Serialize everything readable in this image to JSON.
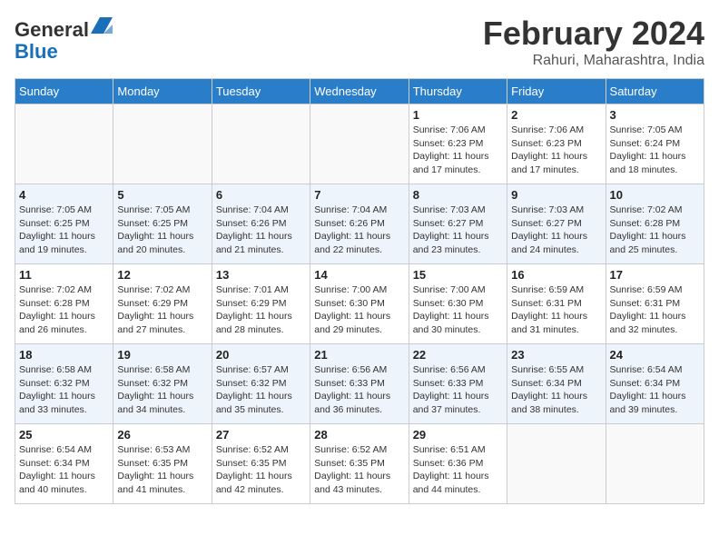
{
  "header": {
    "logo_general": "General",
    "logo_blue": "Blue",
    "month_year": "February 2024",
    "location": "Rahuri, Maharashtra, India"
  },
  "days_of_week": [
    "Sunday",
    "Monday",
    "Tuesday",
    "Wednesday",
    "Thursday",
    "Friday",
    "Saturday"
  ],
  "weeks": [
    [
      {
        "day": "",
        "info": ""
      },
      {
        "day": "",
        "info": ""
      },
      {
        "day": "",
        "info": ""
      },
      {
        "day": "",
        "info": ""
      },
      {
        "day": "1",
        "info": "Sunrise: 7:06 AM\nSunset: 6:23 PM\nDaylight: 11 hours and 17 minutes."
      },
      {
        "day": "2",
        "info": "Sunrise: 7:06 AM\nSunset: 6:23 PM\nDaylight: 11 hours and 17 minutes."
      },
      {
        "day": "3",
        "info": "Sunrise: 7:05 AM\nSunset: 6:24 PM\nDaylight: 11 hours and 18 minutes."
      }
    ],
    [
      {
        "day": "4",
        "info": "Sunrise: 7:05 AM\nSunset: 6:25 PM\nDaylight: 11 hours and 19 minutes."
      },
      {
        "day": "5",
        "info": "Sunrise: 7:05 AM\nSunset: 6:25 PM\nDaylight: 11 hours and 20 minutes."
      },
      {
        "day": "6",
        "info": "Sunrise: 7:04 AM\nSunset: 6:26 PM\nDaylight: 11 hours and 21 minutes."
      },
      {
        "day": "7",
        "info": "Sunrise: 7:04 AM\nSunset: 6:26 PM\nDaylight: 11 hours and 22 minutes."
      },
      {
        "day": "8",
        "info": "Sunrise: 7:03 AM\nSunset: 6:27 PM\nDaylight: 11 hours and 23 minutes."
      },
      {
        "day": "9",
        "info": "Sunrise: 7:03 AM\nSunset: 6:27 PM\nDaylight: 11 hours and 24 minutes."
      },
      {
        "day": "10",
        "info": "Sunrise: 7:02 AM\nSunset: 6:28 PM\nDaylight: 11 hours and 25 minutes."
      }
    ],
    [
      {
        "day": "11",
        "info": "Sunrise: 7:02 AM\nSunset: 6:28 PM\nDaylight: 11 hours and 26 minutes."
      },
      {
        "day": "12",
        "info": "Sunrise: 7:02 AM\nSunset: 6:29 PM\nDaylight: 11 hours and 27 minutes."
      },
      {
        "day": "13",
        "info": "Sunrise: 7:01 AM\nSunset: 6:29 PM\nDaylight: 11 hours and 28 minutes."
      },
      {
        "day": "14",
        "info": "Sunrise: 7:00 AM\nSunset: 6:30 PM\nDaylight: 11 hours and 29 minutes."
      },
      {
        "day": "15",
        "info": "Sunrise: 7:00 AM\nSunset: 6:30 PM\nDaylight: 11 hours and 30 minutes."
      },
      {
        "day": "16",
        "info": "Sunrise: 6:59 AM\nSunset: 6:31 PM\nDaylight: 11 hours and 31 minutes."
      },
      {
        "day": "17",
        "info": "Sunrise: 6:59 AM\nSunset: 6:31 PM\nDaylight: 11 hours and 32 minutes."
      }
    ],
    [
      {
        "day": "18",
        "info": "Sunrise: 6:58 AM\nSunset: 6:32 PM\nDaylight: 11 hours and 33 minutes."
      },
      {
        "day": "19",
        "info": "Sunrise: 6:58 AM\nSunset: 6:32 PM\nDaylight: 11 hours and 34 minutes."
      },
      {
        "day": "20",
        "info": "Sunrise: 6:57 AM\nSunset: 6:32 PM\nDaylight: 11 hours and 35 minutes."
      },
      {
        "day": "21",
        "info": "Sunrise: 6:56 AM\nSunset: 6:33 PM\nDaylight: 11 hours and 36 minutes."
      },
      {
        "day": "22",
        "info": "Sunrise: 6:56 AM\nSunset: 6:33 PM\nDaylight: 11 hours and 37 minutes."
      },
      {
        "day": "23",
        "info": "Sunrise: 6:55 AM\nSunset: 6:34 PM\nDaylight: 11 hours and 38 minutes."
      },
      {
        "day": "24",
        "info": "Sunrise: 6:54 AM\nSunset: 6:34 PM\nDaylight: 11 hours and 39 minutes."
      }
    ],
    [
      {
        "day": "25",
        "info": "Sunrise: 6:54 AM\nSunset: 6:34 PM\nDaylight: 11 hours and 40 minutes."
      },
      {
        "day": "26",
        "info": "Sunrise: 6:53 AM\nSunset: 6:35 PM\nDaylight: 11 hours and 41 minutes."
      },
      {
        "day": "27",
        "info": "Sunrise: 6:52 AM\nSunset: 6:35 PM\nDaylight: 11 hours and 42 minutes."
      },
      {
        "day": "28",
        "info": "Sunrise: 6:52 AM\nSunset: 6:35 PM\nDaylight: 11 hours and 43 minutes."
      },
      {
        "day": "29",
        "info": "Sunrise: 6:51 AM\nSunset: 6:36 PM\nDaylight: 11 hours and 44 minutes."
      },
      {
        "day": "",
        "info": ""
      },
      {
        "day": "",
        "info": ""
      }
    ]
  ]
}
